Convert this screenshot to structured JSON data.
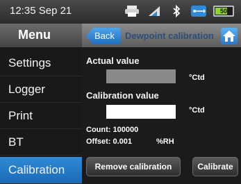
{
  "status_bar": {
    "time": "12:35",
    "date": "Sep 21",
    "battery_label": "50",
    "icons": [
      "printer-icon",
      "signal-icon",
      "bluetooth-icon",
      "usb-icon",
      "battery-icon"
    ]
  },
  "menu": {
    "title": "Menu",
    "items": [
      {
        "label": "Settings"
      },
      {
        "label": "Logger"
      },
      {
        "label": "Print"
      },
      {
        "label": "BT"
      },
      {
        "label": "Calibration"
      }
    ]
  },
  "panel": {
    "back_label": "Back",
    "title": "Dewpoint calibration",
    "actual_value_label": "Actual value",
    "actual_unit": "°Ctd",
    "calibration_value_label": "Calibration value",
    "calibration_unit": "°Ctd",
    "count_text": "Count: 100000",
    "offset_text": "Offset: 0.001",
    "offset_unit": "%RH",
    "remove_button": "Remove calibration",
    "calibrate_button": "Calibrate"
  },
  "colors": {
    "accent": "#2f8ad8",
    "actual_field": "#8a8a8a",
    "calibration_field": "#ffffff"
  }
}
